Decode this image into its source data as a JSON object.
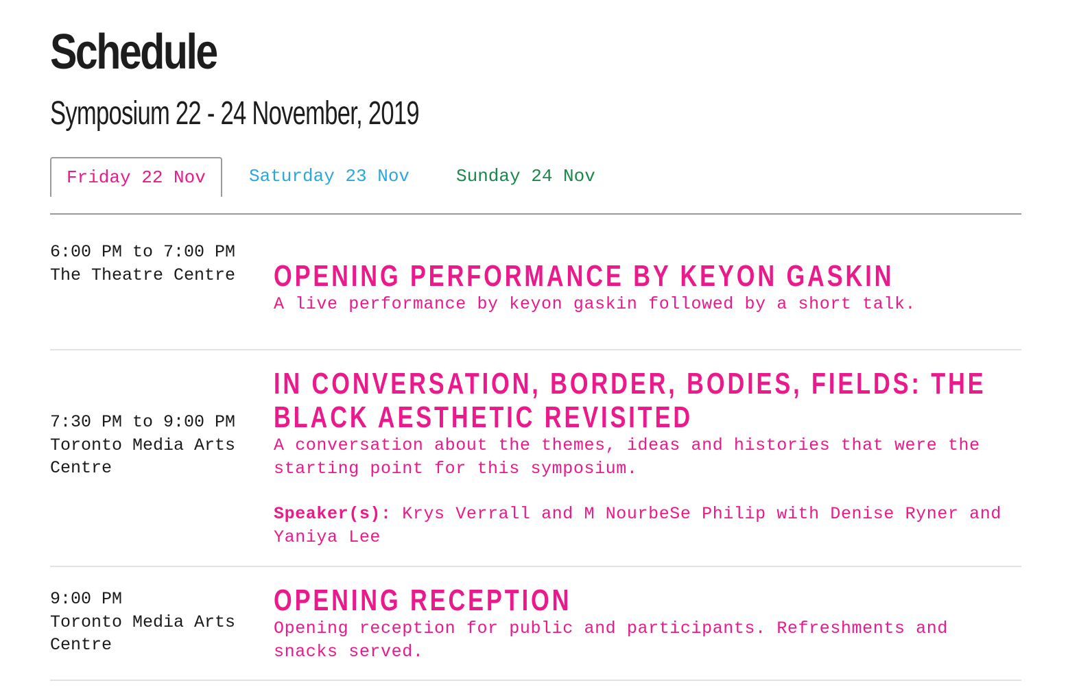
{
  "header": {
    "title": "Schedule",
    "subtitle": "Symposium 22 - 24 November, 2019"
  },
  "tabs": [
    {
      "label": "Friday 22 Nov",
      "color": "#ea1a8c",
      "active": true
    },
    {
      "label": "Saturday 23 Nov",
      "color": "#2ba7de",
      "active": false
    },
    {
      "label": "Sunday 24 Nov",
      "color": "#19884a",
      "active": false
    }
  ],
  "events": [
    {
      "time": "6:00 PM to 7:00 PM",
      "location": "The Theatre Centre",
      "title": "Opening Performance by keyon gaskin",
      "description": "A live performance by keyon gaskin followed by a short talk.",
      "speakers_label": "",
      "speakers": ""
    },
    {
      "time": "7:30 PM to 9:00 PM",
      "location": "Toronto Media Arts Centre",
      "title": "In Conversation, Border, Bodies, Fields: The Black Aesthetic Revisited",
      "description": "A conversation about the themes, ideas and histories that were the starting point for this symposium.",
      "speakers_label": "Speaker(s):",
      "speakers": "Krys Verrall and M NourbeSe Philip with Denise Ryner and Yaniya Lee"
    },
    {
      "time": "9:00 PM",
      "location": "Toronto Media Arts Centre",
      "title": "Opening Reception",
      "description": "Opening reception for public and participants. Refreshments and snacks served.",
      "speakers_label": "",
      "speakers": ""
    }
  ],
  "colors": {
    "accent": "#ea1a8c",
    "saturday": "#2ba7de",
    "sunday": "#19884a",
    "text": "#1a1a1a",
    "rule": "#e2e2e2"
  }
}
